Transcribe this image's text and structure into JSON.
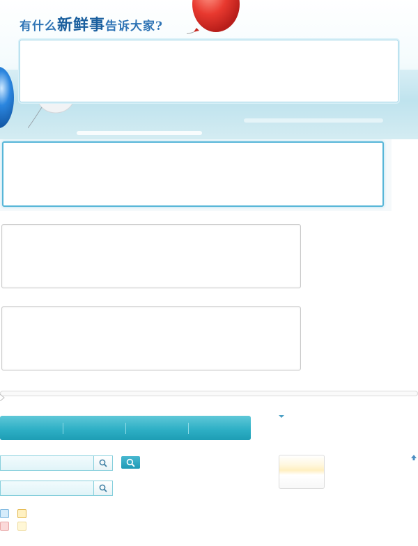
{
  "hero": {
    "title_prefix": "有什么",
    "title_emphasis": "新鲜事",
    "title_suffix": "告诉大家?",
    "input_value": ""
  },
  "editor": {
    "main_value": "",
    "box1_value": "",
    "box2_value": ""
  },
  "tabs": [
    {
      "label": ""
    },
    {
      "label": ""
    },
    {
      "label": ""
    },
    {
      "label": ""
    }
  ],
  "search": {
    "primary_value": "",
    "secondary_value": ""
  },
  "colors": {
    "accent": "#2fb0c6",
    "title_blue": "#2f74b5",
    "balloon_red": "#e8392f",
    "balloon_blue": "#1e6fc4",
    "swatch_blue": "#d6ecfb",
    "swatch_yellow": "#fff1c2",
    "swatch_pink": "#fbd9d9",
    "swatch_cream": "#fff7d6"
  },
  "icons": [
    "search-icon",
    "up-arrow-icon",
    "chevron-down-icon",
    "balloon-icon"
  ]
}
